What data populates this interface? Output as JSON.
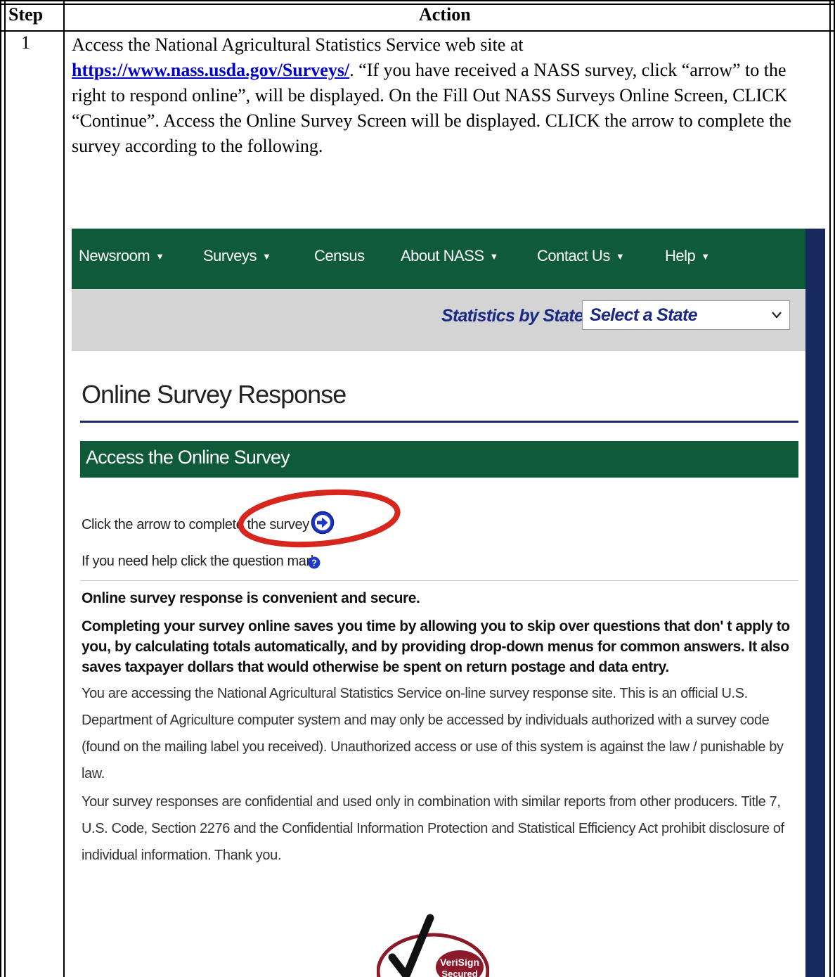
{
  "table": {
    "header_step": "Step",
    "header_action": "Action",
    "step_number": "1"
  },
  "instructions": {
    "part1": "Access the National Agricultural Statistics Service web site at",
    "link": "https://www.nass.usda.gov/Surveys/",
    "part2": ".  “If you have received a NASS survey, click “arrow” to the right to respond online”, will be displayed.  On the Fill Out NASS Surveys Online Screen, CLICK “Continue”.   Access the Online Survey Screen will be displayed.  CLICK the arrow to complete the survey according to the following."
  },
  "screenshot": {
    "nav": {
      "newsroom": "Newsroom",
      "surveys": "Surveys",
      "census": "Census",
      "about": "About NASS",
      "contact": "Contact Us",
      "help": "Help"
    },
    "stats_by_state_label": "Statistics by State",
    "state_select_value": "Select a State",
    "page_title": "Online Survey Response",
    "section_title": "Access the Online Survey",
    "click_arrow_text": "Click the arrow to complete the survey",
    "help_text": "If you need help click the question mark",
    "bold_heading": "Online survey response is convenient and secure.",
    "bold_paragraph": "Completing your survey online saves you time by allowing you to skip over questions that don' t apply to you, by calculating totals automatically, and by providing drop-down menus for common answers. It also saves taxpayer dollars that would otherwise be spent on return postage and data entry.",
    "paragraph1": "You are accessing the National Agricultural Statistics Service on-line survey response site. This is an official U.S. Department of Agriculture computer system and may only be accessed by individuals authorized with a survey code (found on the mailing label you received). Unauthorized access or use of this system is against the law / punishable by law.",
    "paragraph2": "Your survey responses are confidential and used only in combination with similar reports from other producers. Title 7, U.S. Code, Section 2276 and the Confidential Information Protection and Statistical Efficiency Act prohibit disclosure of individual information. Thank you.",
    "verisign_line1": "VeriSign",
    "verisign_line2": "Secured"
  },
  "colors": {
    "nav_green": "#0e5a39",
    "link_blue": "#0000cc",
    "state_blue": "#1a2a86",
    "highlight_red": "#d7261e"
  }
}
